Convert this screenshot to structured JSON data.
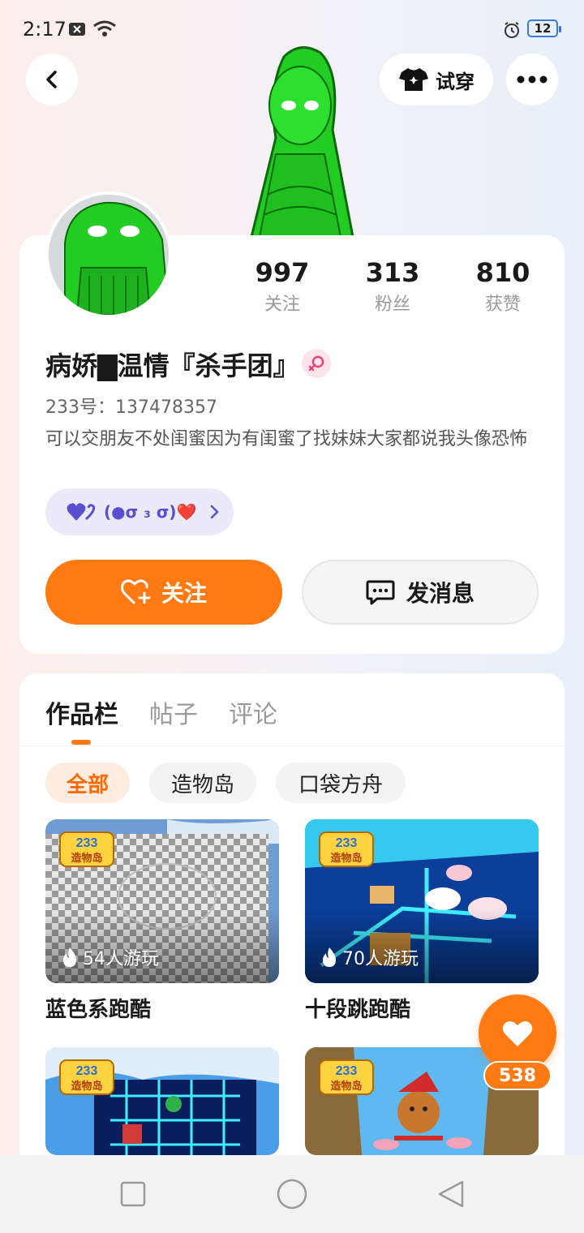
{
  "status_bar": {
    "time": "2:17",
    "battery": "12"
  },
  "header": {
    "try_on_label": "试穿"
  },
  "profile": {
    "stats": [
      {
        "value": "997",
        "label": "关注"
      },
      {
        "value": "313",
        "label": "粉丝"
      },
      {
        "value": "810",
        "label": "获赞"
      }
    ],
    "username": "病娇▇温情『杀手团』",
    "uid": "233号：137478357",
    "bio": "可以交朋友不处闺蜜因为有闺蜜了找妹妹大家都说我头像恐怖",
    "tag_text": "(●σ ₃ σ)❤️",
    "follow_label": "关注",
    "message_label": "发消息"
  },
  "tabs": [
    {
      "label": "作品栏",
      "active": true
    },
    {
      "label": "帖子",
      "active": false
    },
    {
      "label": "评论",
      "active": false
    }
  ],
  "filters": [
    {
      "label": "全部",
      "active": true
    },
    {
      "label": "造物岛",
      "active": false
    },
    {
      "label": "口袋方舟",
      "active": false
    }
  ],
  "games": [
    {
      "title": "蓝色系跑酷",
      "play_count": "54人游玩"
    },
    {
      "title": "十段跳跑酷",
      "play_count": "70人游玩"
    }
  ],
  "logo_text": "233 造物岛",
  "floating_like": {
    "count": "538"
  },
  "colors": {
    "accent": "#ff7a12",
    "tag_bg": "#ece9fb",
    "tag_text": "#5a4fcf"
  }
}
